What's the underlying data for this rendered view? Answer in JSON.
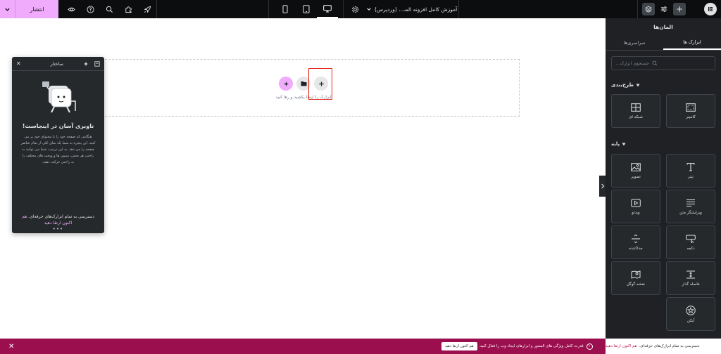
{
  "topbar": {
    "publish_label": "انتشار",
    "document_title": "آموزش کامل افزونه المـ... (وردپرس)",
    "icons": [
      "chevron-down-icon",
      "eye-icon",
      "help-icon",
      "search-icon",
      "puzzle-icon",
      "rocket-icon",
      "mobile-icon",
      "tablet-icon",
      "desktop-icon",
      "gear-icon",
      "layers-icon",
      "sliders-icon",
      "plus-icon",
      "elementor-logo"
    ]
  },
  "canvas": {
    "drop_hint": "ابزارک را اینجا بکشید و رها کنید"
  },
  "structure_panel": {
    "title": "ساختار",
    "heading": "ناوبری آسان در اینجاست!",
    "body": "هنگامی که صفحه خود را با محتوای خود پر می کنید، این پنجره به شما یک نمای کلی از تمام عناصر صفحه را می دهد. به این ترتیب، شما می توانید به راحتی هر بخش، ستون ها و ویجت های مختلف را به راحتی حرکت دهید.",
    "promo_text": "دسترسی به تمام ابزارک‌های حرفه‌ای.",
    "promo_link": "هم اکنون ارتقا دهید",
    "dots": "•••"
  },
  "panel": {
    "title": "المان‌ها",
    "tabs": [
      "ابزارک ها",
      "سراسری‌ها"
    ],
    "search_placeholder": "جستجوی ابزارک...",
    "layout_section": "طرح‌بندی",
    "layout_widgets": [
      {
        "label": "کانتینر",
        "icon": "container-icon"
      },
      {
        "label": "شبکه ای",
        "icon": "grid-icon"
      }
    ],
    "basic_section": "پایه",
    "basic_widgets": [
      {
        "label": "تیتر",
        "icon": "heading-icon"
      },
      {
        "label": "تصویر",
        "icon": "image-icon"
      },
      {
        "label": "ویرایشگر متن",
        "icon": "text-editor-icon"
      },
      {
        "label": "ویدئو",
        "icon": "video-icon"
      },
      {
        "label": "دکمه",
        "icon": "button-icon"
      },
      {
        "label": "جداکننده",
        "icon": "divider-icon"
      },
      {
        "label": "فاصله گذار",
        "icon": "spacer-icon"
      },
      {
        "label": "نقشه گوگل",
        "icon": "map-icon"
      },
      {
        "label": "آیکن",
        "icon": "star-icon"
      }
    ]
  },
  "bottombar": {
    "close": "✕",
    "cta": "هم اکنون ارتقا دهید",
    "message": "قدرت کامل ویژگی های المنتور و ابزارهای ایجاد وب را فعال کنید.",
    "panel_text": "دسترسی به تمام ابزارک‌های حرفه‌ای.",
    "panel_link": "هم اکنون ارتقا دهید"
  }
}
